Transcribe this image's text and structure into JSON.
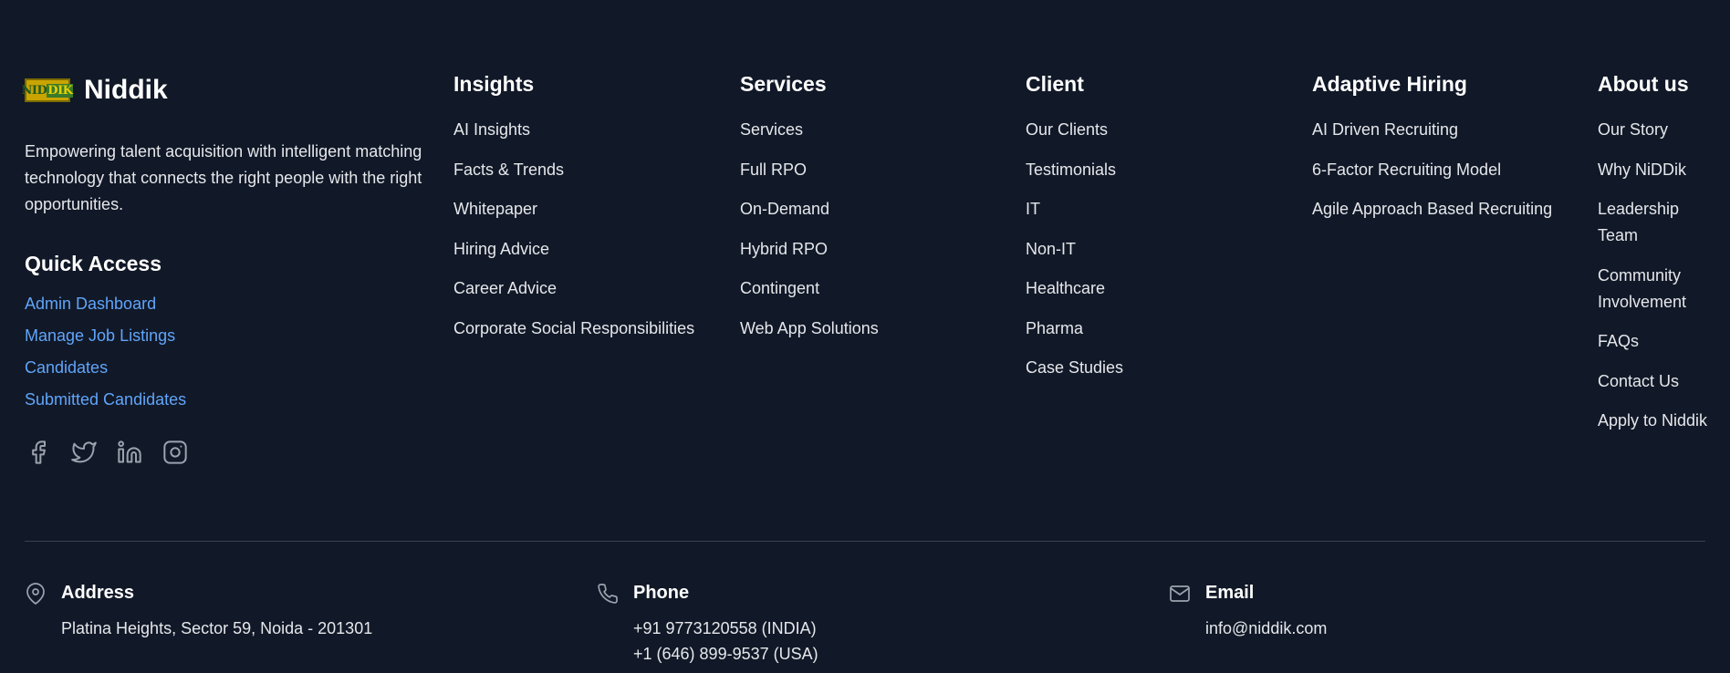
{
  "brand": {
    "logo_text_left": "NID",
    "logo_text_right": "DIK",
    "name": "Niddik",
    "tagline": "Empowering talent acquisition with intelligent matching technology that connects the right people with the right opportunities."
  },
  "quick_access": {
    "title": "Quick Access",
    "links": [
      "Admin Dashboard",
      "Manage Job Listings",
      "Candidates",
      "Submitted Candidates"
    ]
  },
  "social": [
    {
      "icon": "facebook-icon"
    },
    {
      "icon": "twitter-icon"
    },
    {
      "icon": "linkedin-icon"
    },
    {
      "icon": "instagram-icon"
    }
  ],
  "columns": {
    "insights": {
      "title": "Insights",
      "links": [
        "AI Insights",
        "Facts & Trends",
        "Whitepaper",
        "Hiring Advice",
        "Career Advice",
        "Corporate Social Responsibilities"
      ]
    },
    "services": {
      "title": "Services",
      "links": [
        "Services",
        "Full RPO",
        "On-Demand",
        "Hybrid RPO",
        "Contingent",
        "Web App Solutions"
      ]
    },
    "client": {
      "title": "Client",
      "links": [
        "Our Clients",
        "Testimonials",
        "IT",
        "Non-IT",
        "Healthcare",
        "Pharma",
        "Case Studies"
      ]
    },
    "adaptive": {
      "title": "Adaptive Hiring",
      "links": [
        "AI Driven Recruiting",
        "6-Factor Recruiting Model",
        "Agile Approach Based Recruiting"
      ]
    },
    "about": {
      "title": "About us",
      "links": [
        "Our Story",
        "Why NiDDik",
        "Leadership Team",
        "Community Involvement",
        "FAQs",
        "Contact Us",
        "Apply to Niddik"
      ]
    }
  },
  "contact": {
    "address": {
      "title": "Address",
      "lines": [
        "Platina Heights, Sector 59, Noida - 201301"
      ]
    },
    "phone": {
      "title": "Phone",
      "lines": [
        "+91 9773120558 (INDIA)",
        "+1 (646) 899-9537 (USA)"
      ]
    },
    "email": {
      "title": "Email",
      "lines": [
        "info@niddik.com"
      ]
    }
  },
  "colors": {
    "background": "#111827",
    "link_accent": "#60a5fa",
    "divider": "#374151"
  }
}
